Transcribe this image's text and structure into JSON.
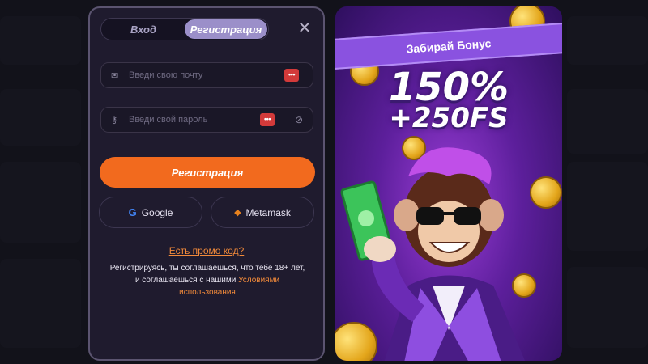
{
  "auth_modal": {
    "tabs": [
      {
        "label": "Вход",
        "active": false
      },
      {
        "label": "Регистрация",
        "active": true
      }
    ],
    "email": {
      "placeholder": "Введи свою почту",
      "value": ""
    },
    "password": {
      "placeholder": "Введи свой пароль",
      "value": ""
    },
    "submit_label": "Регистрация",
    "social": {
      "google_label": "Google",
      "metamask_label": "Metamask"
    },
    "promo_link": "Есть промо код?",
    "terms_text": "Регистрируясь, ты соглашаешься, что тебе 18+ лет, и соглашаешься с нашими",
    "terms_link": "Условиями использования"
  },
  "promo_banner": {
    "ribbon": "Забирай Бонус",
    "headline": "150%",
    "subline": "+250FS"
  },
  "colors": {
    "accent": "#f26a1e",
    "active_tab": "#9b8fc9",
    "modal_bg": "#1f1b2e",
    "banner_purple": "#8a52e0"
  },
  "icons": {
    "email": "envelope-icon",
    "password": "key-icon",
    "password_badge": "password-manager-icon",
    "visibility": "eye-icon",
    "close": "close-icon",
    "google": "google-icon",
    "metamask": "metamask-fox-icon"
  }
}
